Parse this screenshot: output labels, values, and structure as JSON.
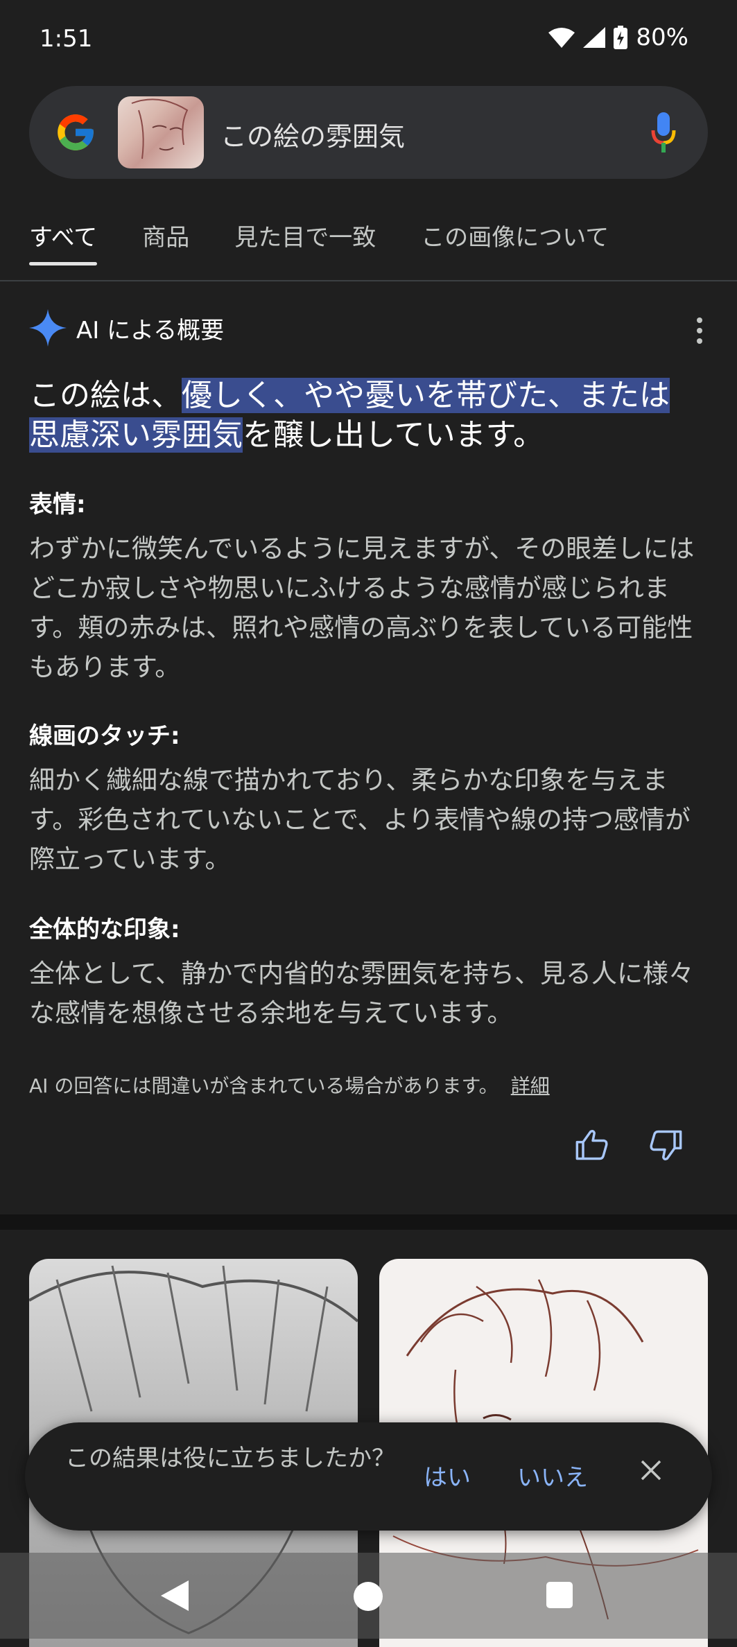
{
  "status_bar": {
    "time": "1:51",
    "battery": "80%"
  },
  "search": {
    "query": "この絵の雰囲気"
  },
  "tabs": [
    {
      "label": "すべて",
      "active": true
    },
    {
      "label": "商品"
    },
    {
      "label": "見た目で一致"
    },
    {
      "label": "この画像について"
    }
  ],
  "ai_overview": {
    "title": "AI による概要",
    "lead_before": "この絵は、",
    "lead_highlight": "優しく、やや憂いを帯びた、または思慮深い雰囲気",
    "lead_after": "を醸し出しています。",
    "sections": [
      {
        "heading": "表情:",
        "body": "わずかに微笑んでいるように見えますが、その眼差しにはどこか寂しさや物思いにふけるような感情が感じられます。頬の赤みは、照れや感情の高ぶりを表している可能性もあります。"
      },
      {
        "heading": "線画のタッチ:",
        "body": "細かく繊細な線で描かれており、柔らかな印象を与えます。彩色されていないことで、より表情や線の持つ感情が際立っています。"
      },
      {
        "heading": "全体的な印象:",
        "body": "全体として、静かで内省的な雰囲気を持ち、見る人に様々な感情を想像させる余地を与えています。"
      }
    ],
    "disclaimer": "AI の回答には間違いが含まれている場合があります。",
    "details_link": "詳細"
  },
  "feedback_toast": {
    "question": "この結果は役に立ちましたか？",
    "yes": "はい",
    "no": "いいえ"
  },
  "colors": {
    "background": "#1f1f1f",
    "highlight": "#3a4d8f",
    "link": "#8ab4f8"
  }
}
